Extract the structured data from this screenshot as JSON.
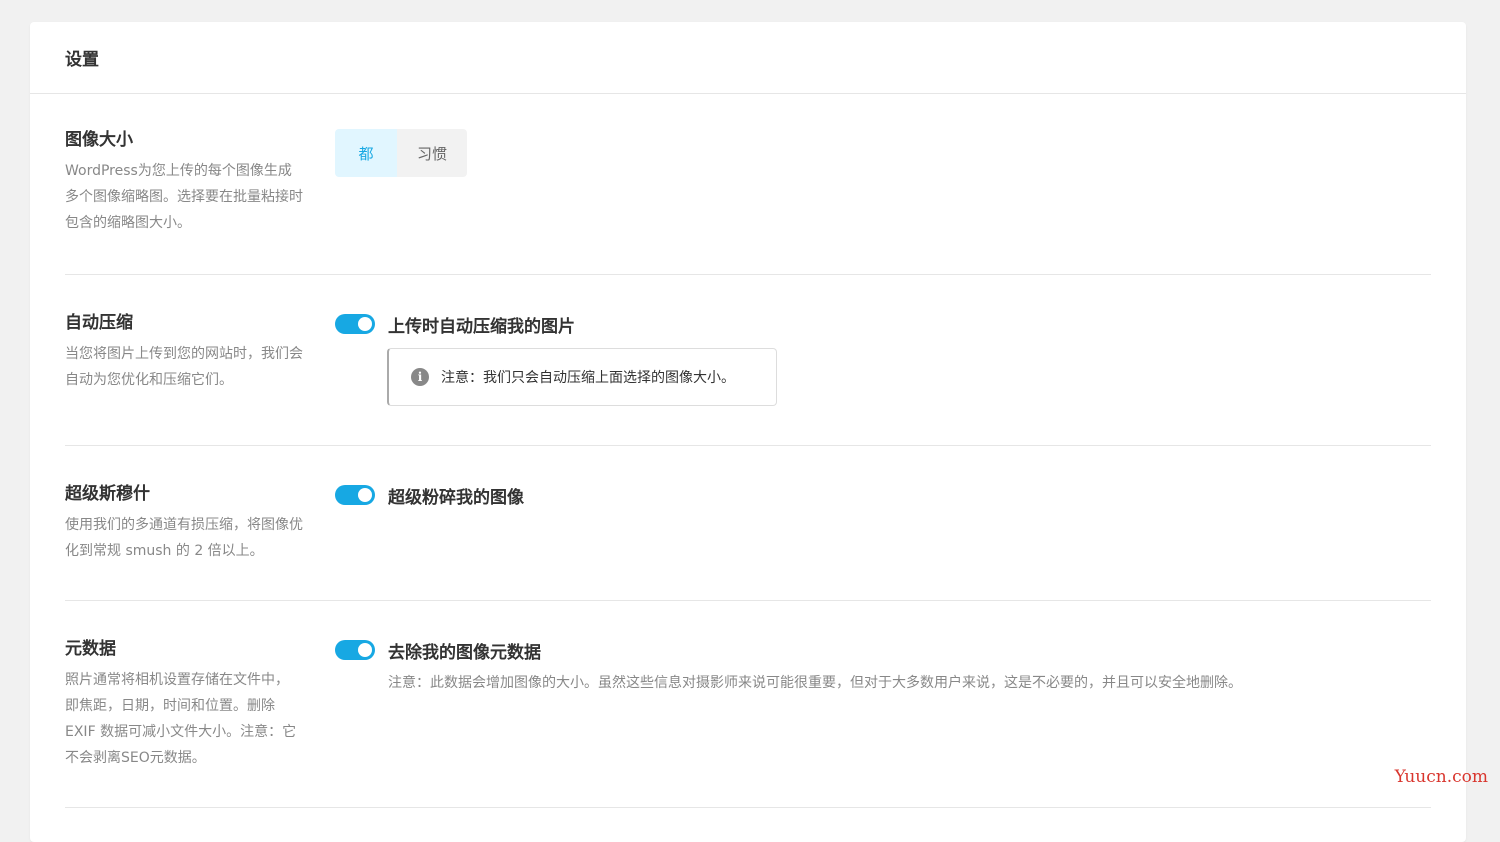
{
  "header": {
    "title": "设置"
  },
  "rows": {
    "image_size": {
      "title": "图像大小",
      "description": "WordPress为您上传的每个图像生成多个图像缩略图。选择要在批量粘接时包含的缩略图大小。",
      "options": [
        "都",
        "习惯"
      ],
      "selected": "都"
    },
    "auto_compress": {
      "title": "自动压缩",
      "description": "当您将图片上传到您的网站时，我们会自动为您优化和压缩它们。",
      "toggle_label": "上传时自动压缩我的图片",
      "toggle_on": true,
      "notice": "注意：我们只会自动压缩上面选择的图像大小。"
    },
    "super_smush": {
      "title": "超级斯穆什",
      "description": "使用我们的多通道有损压缩，将图像优化到常规 smush 的 2 倍以上。",
      "toggle_label": "超级粉碎我的图像",
      "toggle_on": true
    },
    "metadata": {
      "title": "元数据",
      "description": "照片通常将相机设置存储在文件中，即焦距，日期，时间和位置。删除 EXIF 数据可减小文件大小。注意：它不会剥离SEO元数据。",
      "toggle_label": "去除我的图像元数据",
      "toggle_on": true,
      "note": "注意：此数据会增加图像的大小。虽然这些信息对摄影师来说可能很重要，但对于大多数用户来说，这是不必要的，并且可以安全地删除。"
    }
  },
  "watermark": "Yuucn.com",
  "colors": {
    "accent": "#17a8e3",
    "accent_light": "#e1f6ff",
    "background": "#f1f1f1",
    "watermark": "#d9362e"
  },
  "icons": {
    "notice": "info-icon"
  }
}
